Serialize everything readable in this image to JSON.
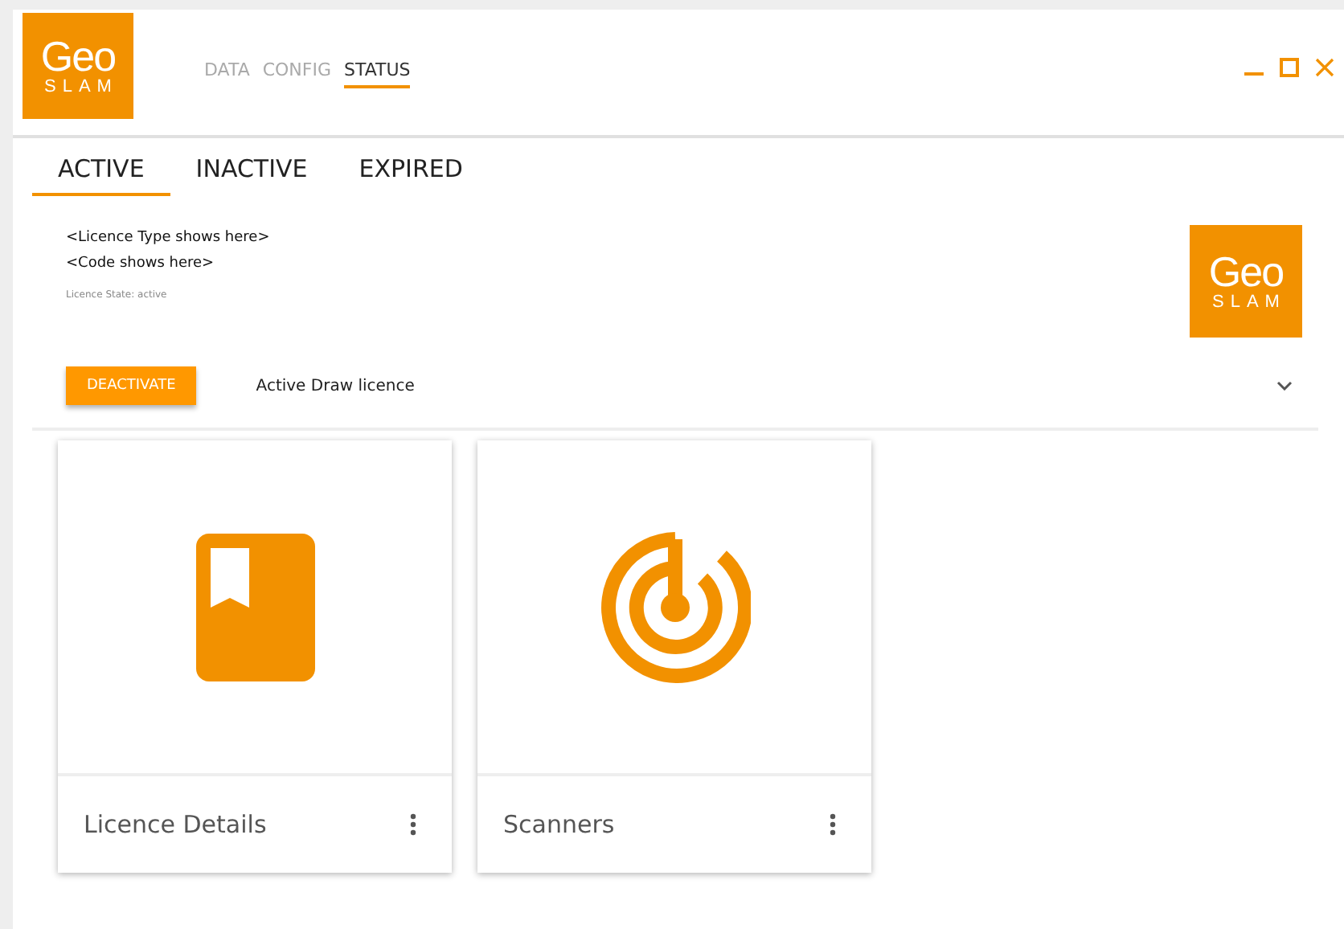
{
  "header": {
    "logo": {
      "mark": "Geo",
      "name": "SLAM"
    },
    "nav": [
      {
        "label": "DATA",
        "selected": false
      },
      {
        "label": "CONFIG",
        "selected": false
      },
      {
        "label": "STATUS",
        "selected": true
      }
    ]
  },
  "tabs": [
    {
      "label": "ACTIVE",
      "selected": true
    },
    {
      "label": "INACTIVE",
      "selected": false
    },
    {
      "label": "EXPIRED",
      "selected": false
    }
  ],
  "licence": {
    "type": "<Licence Type shows here>",
    "code": "<Code shows here>",
    "state": "Licence State: active",
    "logo": {
      "mark": "Geo",
      "name": "SLAM"
    },
    "button": "DEACTIVATE",
    "description": "Active Draw licence"
  },
  "cards": [
    {
      "kind": "book",
      "title": "Licence Details"
    },
    {
      "kind": "target",
      "title": "Scanners"
    }
  ]
}
